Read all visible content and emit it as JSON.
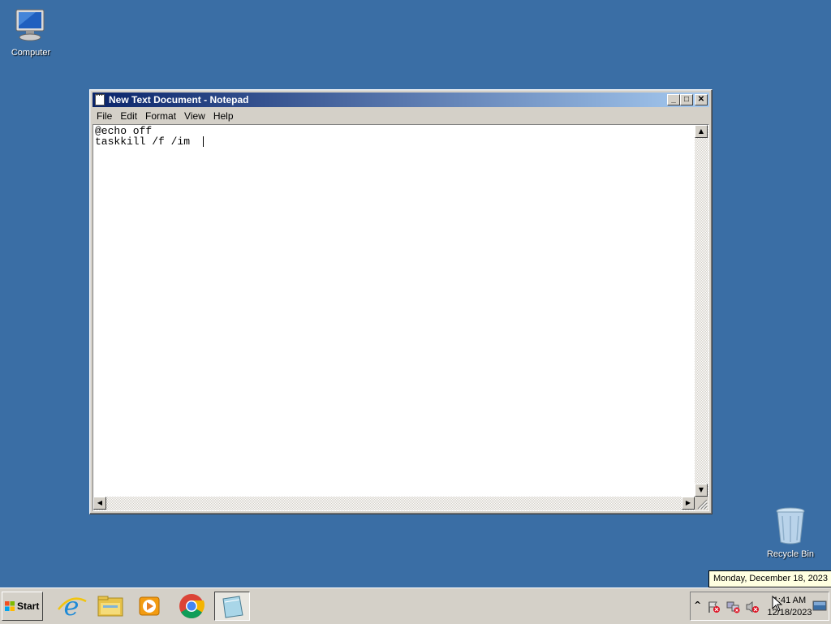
{
  "desktop": {
    "icons": [
      {
        "label": "Computer",
        "icon": "computer-icon"
      },
      {
        "label": "Recycle Bin",
        "icon": "recycle-bin-icon"
      }
    ]
  },
  "window": {
    "title": "New Text Document - Notepad",
    "icon": "notepad-icon",
    "controls": {
      "minimize": "_",
      "maximize": "□",
      "close": "✕"
    },
    "menu": [
      "File",
      "Edit",
      "Format",
      "View",
      "Help"
    ],
    "content_lines": [
      "@echo off",
      "taskkill /f /im "
    ]
  },
  "taskbar": {
    "start_label": "Start",
    "pinned": [
      {
        "name": "internet-explorer-icon"
      },
      {
        "name": "file-explorer-icon"
      },
      {
        "name": "media-player-icon"
      },
      {
        "name": "chrome-icon"
      },
      {
        "name": "notepad-icon",
        "active": true
      }
    ],
    "tray": {
      "icons": [
        "show-hidden-icons-chevron",
        "action-center-flag-icon",
        "network-icon",
        "volume-muted-icon",
        "show-desktop-icon"
      ],
      "time": "1:41 AM",
      "date": "12/18/2023"
    }
  },
  "tooltip": {
    "text": "Monday, December 18, 2023"
  },
  "colors": {
    "desktop": "#3a6ea5",
    "titlebar_start": "#0a246a",
    "titlebar_end": "#a6caf0",
    "taskbar": "#d4d0c8",
    "tooltip": "#ffffe1"
  }
}
